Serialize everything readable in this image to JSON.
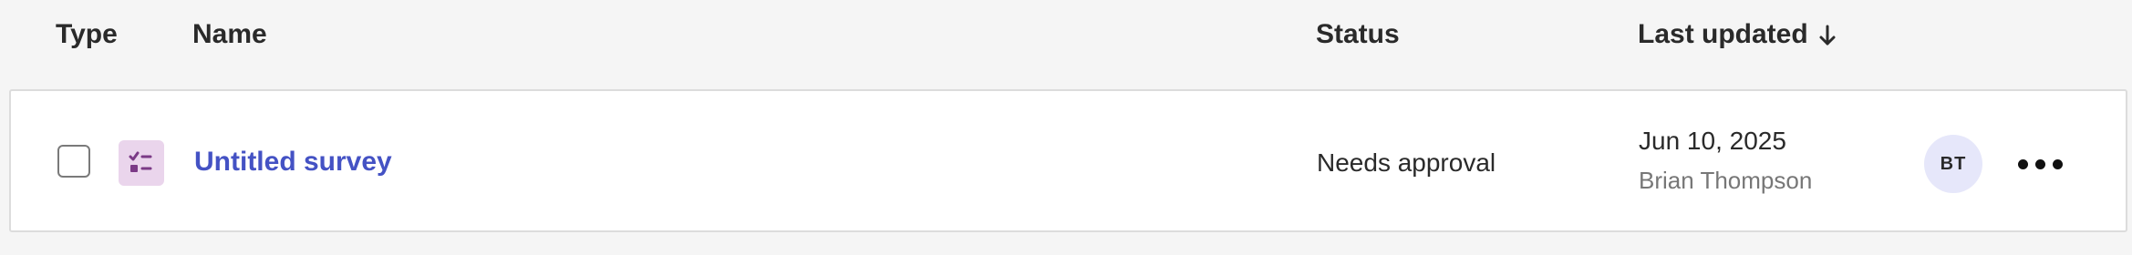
{
  "table": {
    "columns": {
      "type": "Type",
      "name": "Name",
      "status": "Status",
      "last_updated": "Last updated"
    },
    "sort": {
      "column": "last_updated",
      "direction": "descending",
      "icon": "arrow-down-icon"
    },
    "rows": [
      {
        "type_icon": "survey-checklist-icon",
        "name": "Untitled survey",
        "status": "Needs approval",
        "updated_date": "Jun 10, 2025",
        "updated_by": "Brian Thompson",
        "avatar_initials": "BT",
        "selected": false
      }
    ]
  },
  "colors": {
    "link": "#4452c4",
    "type_icon_bg": "#ead5ec",
    "type_icon_fg": "#7b3a86",
    "avatar_bg": "#e6e7fa",
    "background": "#f5f5f5"
  }
}
